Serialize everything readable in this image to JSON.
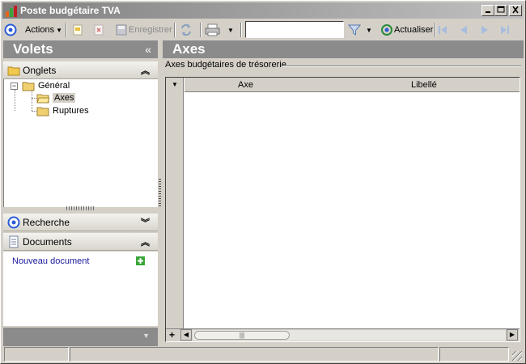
{
  "window": {
    "title": "Poste budgétaire TVA",
    "controls": [
      "minimize",
      "maximize",
      "close"
    ]
  },
  "toolbar": {
    "actions_label": "Actions",
    "save_label": "Enregistrer",
    "search_value": "",
    "refresh_label": "Actualiser",
    "icons": [
      "actions-icon",
      "new-icon",
      "delete-icon",
      "save-icon",
      "sync-icon",
      "print-icon",
      "filter-icon",
      "refresh-icon",
      "first-icon",
      "previous-icon",
      "next-icon",
      "last-icon"
    ]
  },
  "left_pane": {
    "title": "Volets",
    "sections": {
      "onglets": "Onglets",
      "recherche": "Recherche",
      "documents": "Documents"
    },
    "tree": {
      "root": "Général",
      "children": [
        "Axes",
        "Ruptures"
      ],
      "selected": "Axes"
    },
    "documents": {
      "new_link": "Nouveau document"
    }
  },
  "main": {
    "title": "Axes",
    "group_title": "Axes budgétaires de trésorerie",
    "grid": {
      "columns": [
        "Axe",
        "Libellé"
      ],
      "rows": []
    }
  },
  "colors": {
    "pane_header": "#8b8b8b",
    "window_bg": "#d4d0c8",
    "link": "#1a1aa0",
    "accent_blue": "#2a5bd7"
  }
}
